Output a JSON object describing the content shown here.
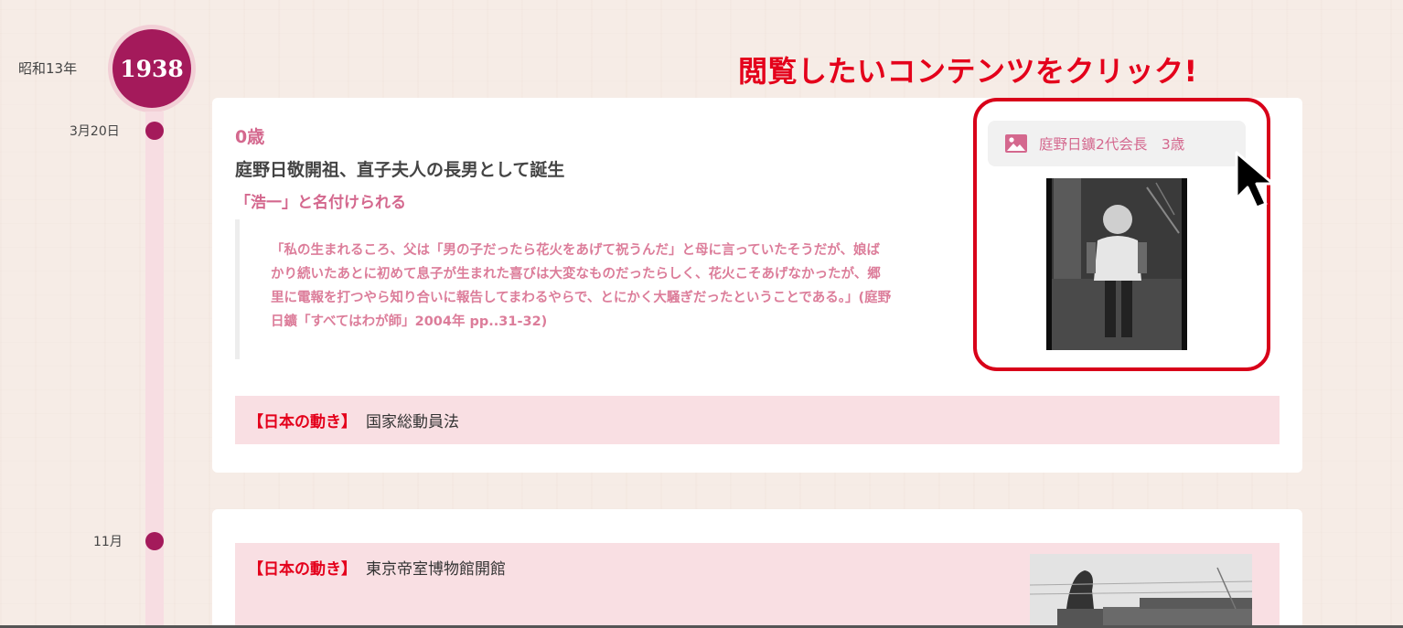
{
  "era": {
    "japanese_year": "昭和13年",
    "year": "1938"
  },
  "cta": "閲覧したいコンテンツをクリック!",
  "timeline": [
    {
      "date": "3月20日",
      "age": "0歳",
      "headline": "庭野日敬開祖、直子夫人の長男として誕生",
      "subhead": "「浩一」と名付けられる",
      "quote": "「私の生まれるころ、父は「男の子だったら花火をあげて祝うんだ」と母に言っていたそうだが、娘ばかり続いたあとに初めて息子が生まれた喜びは大変なものだったらしく、花火こそあげなかったが、郷里に電報を打つやら知り合いに報告してまわるやらで、とにかく大騒ぎだったということである。」(庭野日鑛「すべてはわが師」2004年 pp..31-32)",
      "media": {
        "icon": "image-icon",
        "label": "庭野日鑛2代会長　3歳"
      },
      "news": {
        "tag": "【日本の動き】",
        "text": "国家総動員法"
      }
    },
    {
      "date": "11月",
      "news": {
        "tag": "【日本の動き】",
        "text": "東京帝室博物館開館"
      }
    }
  ],
  "colors": {
    "accent": "#a41a5b",
    "pink_text": "#d4688e",
    "highlight_red": "#e4001b",
    "news_bg": "#f9dfe3"
  }
}
